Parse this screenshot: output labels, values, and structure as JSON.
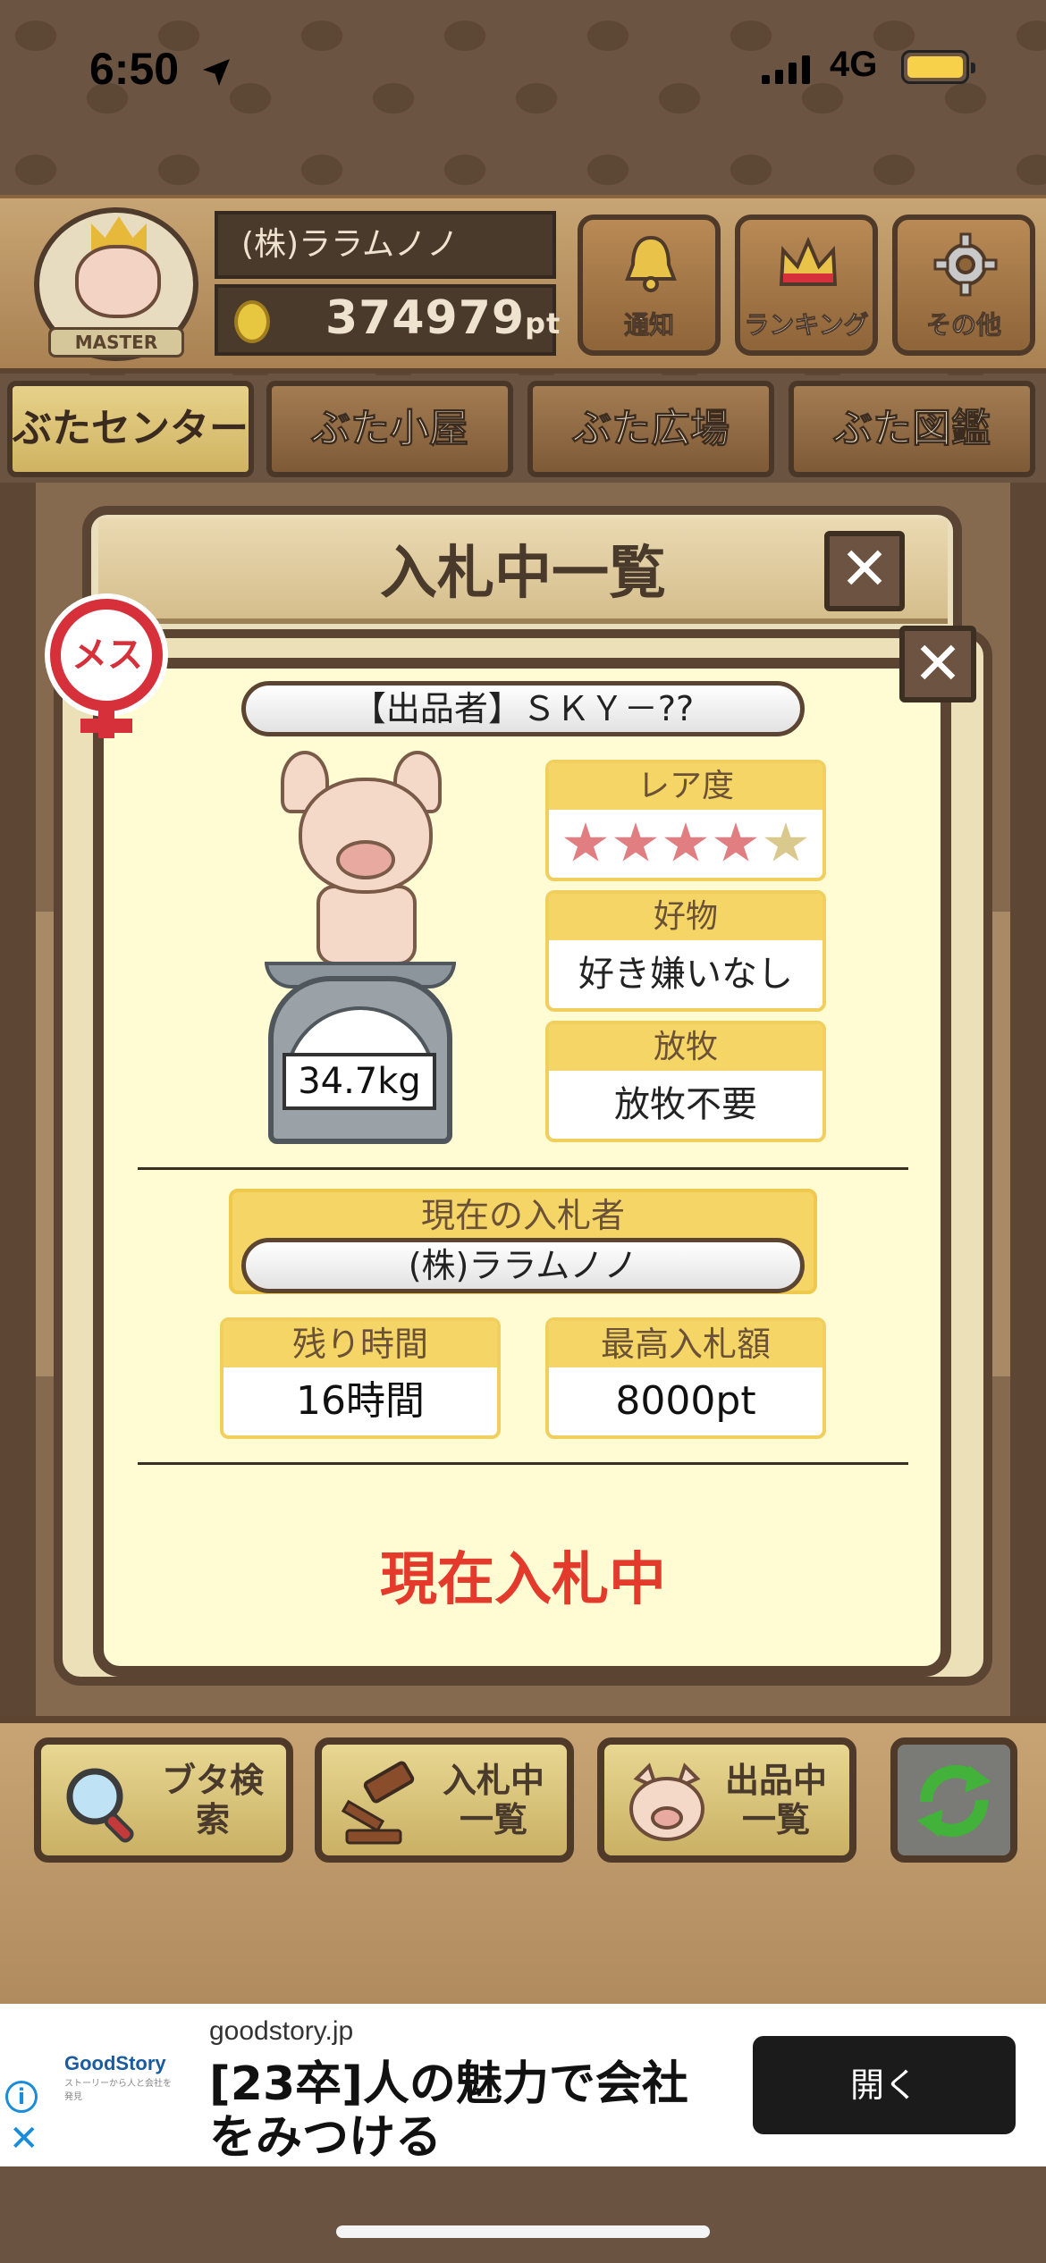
{
  "status_bar": {
    "time": "6:50",
    "network": "4G"
  },
  "header": {
    "badge_label": "MASTER",
    "player_name": "(株)ララムノノ",
    "points_value": "374979",
    "points_unit": "pt",
    "buttons": [
      {
        "label": "通知",
        "icon": "bell-icon"
      },
      {
        "label": "ランキング",
        "icon": "crown-icon"
      },
      {
        "label": "その他",
        "icon": "gear-icon"
      }
    ]
  },
  "nav_tabs": [
    {
      "label": "ぶたセンター",
      "active": true
    },
    {
      "label": "ぶた小屋",
      "active": false
    },
    {
      "label": "ぶた広場",
      "active": false
    },
    {
      "label": "ぶた図鑑",
      "active": false
    }
  ],
  "modal": {
    "title": "入札中一覧",
    "close_glyph": "✕",
    "sex_label": "メス",
    "seller": "【出品者】ＳＫＹ－??",
    "weight": "34.7kg",
    "rarity": {
      "label": "レア度",
      "stars_on": 4,
      "stars_total": 5
    },
    "favorite": {
      "label": "好物",
      "value": "好き嫌いなし"
    },
    "grazing": {
      "label": "放牧",
      "value": "放牧不要"
    },
    "current_bidder": {
      "label": "現在の入札者",
      "value": "(株)ララムノノ"
    },
    "remaining_time": {
      "label": "残り時間",
      "value": "16時間"
    },
    "highest_bid": {
      "label": "最高入札額",
      "value": "8000pt"
    },
    "status": "現在入札中"
  },
  "bottom_buttons": [
    {
      "label": "ブタ検索",
      "icon": "magnifier-icon"
    },
    {
      "label": "入札中\n一覧",
      "icon": "gavel-icon"
    },
    {
      "label": "出品中\n一覧",
      "icon": "pig-face-icon"
    },
    {
      "label": "",
      "icon": "refresh-icon"
    }
  ],
  "ad": {
    "domain": "goodstory.jp",
    "logo_text": "GoodStory",
    "logo_sub": "ストーリーから人と会社を発見",
    "headline": "[23卒]人の魅力で会社をみつける",
    "cta": "開く",
    "info_glyph": "i",
    "close_glyph": "✕"
  },
  "colors": {
    "accent_red": "#e33a2c",
    "wood_dark": "#5b4432",
    "panel_cream": "#fffbd2",
    "label_yellow": "#f5d565"
  }
}
